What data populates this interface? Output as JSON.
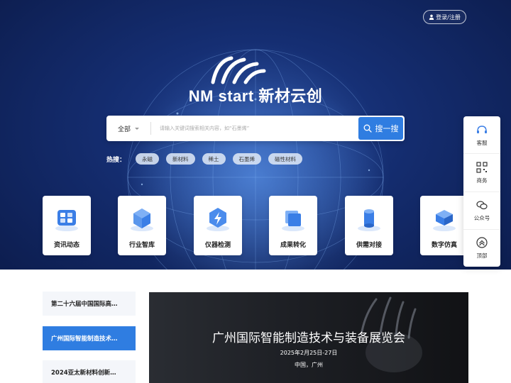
{
  "header": {
    "login_label": "登录/注册",
    "brand": "NM start 新材云创"
  },
  "search": {
    "scope": "全部",
    "placeholder": "请输入关键词搜索相关内容，如“石墨烯”",
    "button_label": "搜一搜"
  },
  "hot": {
    "label": "热搜：",
    "tags": [
      "永磁",
      "新材料",
      "稀土",
      "石墨烯",
      "磁性材料"
    ]
  },
  "tiles": [
    {
      "label": "资讯动态",
      "icon": "news-icon"
    },
    {
      "label": "行业智库",
      "icon": "cube-icon"
    },
    {
      "label": "仪器检测",
      "icon": "instrument-icon"
    },
    {
      "label": "成果转化",
      "icon": "layers-icon"
    },
    {
      "label": "供需对接",
      "icon": "cylinder-icon"
    },
    {
      "label": "数字仿真",
      "icon": "chip-icon"
    }
  ],
  "float_bar": [
    {
      "label": "客服",
      "icon": "service-icon"
    },
    {
      "label": "商务",
      "icon": "qrcode-icon"
    },
    {
      "label": "公众号",
      "icon": "wechat-icon"
    },
    {
      "label": "顶部",
      "icon": "back-to-top-icon"
    }
  ],
  "news": {
    "items": [
      "第二十六届中国国际高…",
      "广州国际智能制造技术…",
      "2024亚太新材料创新…"
    ],
    "active_index": 1
  },
  "banner": {
    "title": "广州国际智能制造技术与装备展览会",
    "date": "2025年2月25日-27日",
    "place": "中国，广州"
  },
  "colors": {
    "accent": "#2f7de1",
    "hero_dark": "#0c1c4c"
  }
}
